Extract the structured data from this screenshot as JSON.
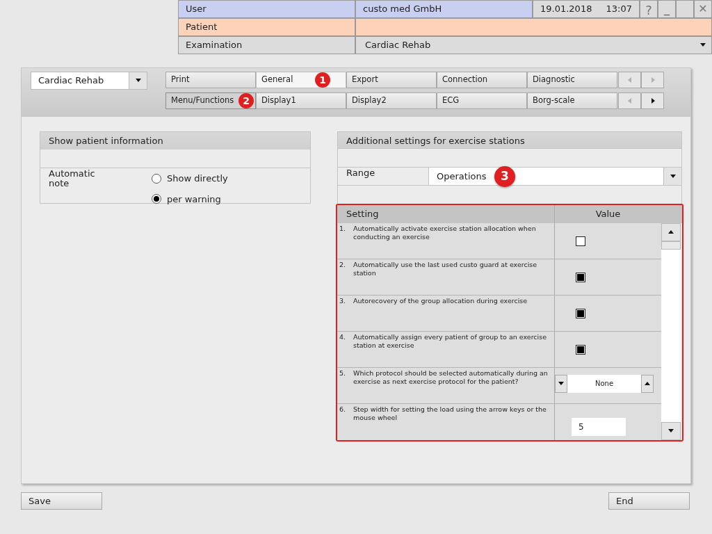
{
  "header": {
    "user_label": "User",
    "user_value": "custo med GmbH",
    "date": "19.01.2018",
    "time": "13:07",
    "help": "?",
    "minimize": "_",
    "close": "✕",
    "patient_label": "Patient",
    "examination_label": "Examination",
    "examination_value": "Cardiac Rehab"
  },
  "module_select": {
    "value": "Cardiac Rehab"
  },
  "tab_rows": [
    {
      "tabs": [
        {
          "label": "Print",
          "selected": false
        },
        {
          "label": "General",
          "selected": true,
          "callout": "1"
        },
        {
          "label": "Export",
          "selected": false
        },
        {
          "label": "Connection",
          "selected": false
        },
        {
          "label": "Diagnostic",
          "selected": false
        }
      ],
      "prev_enabled": false,
      "next_enabled": false
    },
    {
      "tabs": [
        {
          "label": "Menu/Functions",
          "selected": true,
          "callout": "2"
        },
        {
          "label": "Display1",
          "selected": false
        },
        {
          "label": "Display2",
          "selected": false
        },
        {
          "label": "ECG",
          "selected": false
        },
        {
          "label": "Borg-scale",
          "selected": false
        }
      ],
      "prev_enabled": false,
      "next_enabled": true
    }
  ],
  "patient_info": {
    "title": "Show patient information",
    "label": "Automatic note",
    "options": [
      {
        "label": "Show directly",
        "selected": false
      },
      {
        "label": "per warning",
        "selected": true
      }
    ]
  },
  "exercise": {
    "title": "Additional settings for exercise stations",
    "range_label": "Range",
    "range_value": "Operations",
    "range_callout": "3",
    "columns": [
      "Setting",
      "Value"
    ],
    "rows": [
      {
        "number": "1.",
        "text": "Automatically activate exercise station allocation when conducting an exercise",
        "kind": "checkbox",
        "checked": false
      },
      {
        "number": "2.",
        "text": "Automatically use the last used custo guard at exercise station",
        "kind": "checkbox",
        "checked": true
      },
      {
        "number": "3.",
        "text": "Autorecovery of the group allocation during exercise",
        "kind": "checkbox",
        "checked": true
      },
      {
        "number": "4.",
        "text": "Automatically assign every patient of group to an exercise station at exercise",
        "kind": "checkbox",
        "checked": true
      },
      {
        "number": "5.",
        "text": "Which protocol should be selected automatically during an exercise as next exercise protocol for the patient?",
        "kind": "spinner",
        "value": "None"
      },
      {
        "number": "6.",
        "text": "Step width for setting the load using the arrow keys or the mouse wheel",
        "kind": "input",
        "value": "5"
      }
    ]
  },
  "buttons": {
    "save": "Save",
    "end": "End"
  }
}
